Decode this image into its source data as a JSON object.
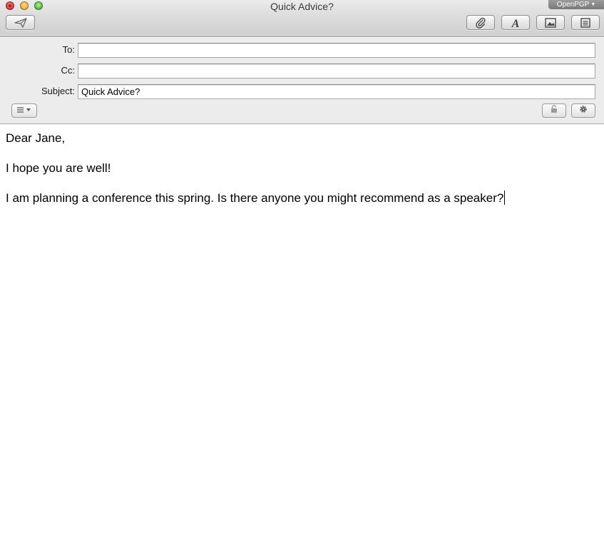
{
  "window": {
    "title": "Quick Advice?",
    "openpgp_label": "OpenPGP"
  },
  "toolbar": {
    "send_icon": "paper-plane-icon",
    "attach_icon": "paperclip-icon",
    "format_icon": "font-icon",
    "photo_icon": "photo-browser-icon",
    "stationery_icon": "stationery-icon"
  },
  "header": {
    "to": {
      "label": "To:",
      "value": ""
    },
    "cc": {
      "label": "Cc:",
      "value": ""
    },
    "subject": {
      "label": "Subject:",
      "value": "Quick Advice?"
    },
    "field_menu_icon": "list-icon",
    "lock_icon": "lock-icon",
    "settings_icon": "gear-icon"
  },
  "message": {
    "paragraphs": [
      "Dear Jane,",
      "I hope you are well!",
      "I am planning a conference this spring. Is there anyone you might recommend as a speaker?"
    ]
  }
}
